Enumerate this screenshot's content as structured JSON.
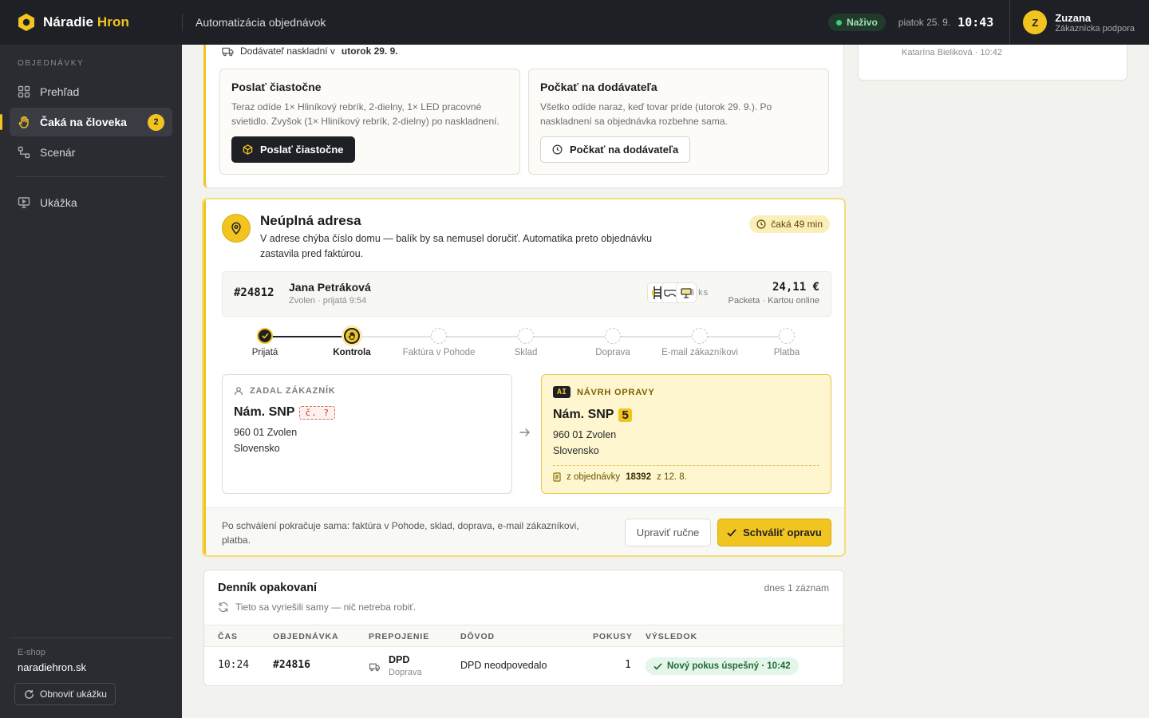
{
  "app": {
    "brand_main": "Náradie",
    "brand_accent": "Hron",
    "title": "Automatizácia objednávok"
  },
  "status": {
    "live": "Naživo",
    "date": "piatok 25. 9.",
    "time": "10:43"
  },
  "user": {
    "initial": "Z",
    "name": "Zuzana",
    "role": "Zákaznícka podpora"
  },
  "sidebar": {
    "section": "OBJEDNÁVKY",
    "items": [
      {
        "label": "Prehľad",
        "icon": "grid-icon"
      },
      {
        "label": "Čaká na človeka",
        "icon": "hand-icon",
        "badge": "2",
        "active": true
      },
      {
        "label": "Scenár",
        "icon": "flow-icon"
      }
    ],
    "extra": {
      "label": "Ukážka",
      "icon": "monitor-icon"
    },
    "footer": {
      "label": "E-shop",
      "value": "naradiehron.sk",
      "reset": "Obnoviť ukážku"
    }
  },
  "stock_card": {
    "supplier_prefix": "Dodávateľ naskladní v",
    "supplier_date": "utorok 29. 9.",
    "options": [
      {
        "title": "Poslať čiastočne",
        "text": "Teraz odíde 1× Hliníkový rebrík, 2-dielny, 1× LED pracovné svietidlo. Zvyšok (1× Hliníkový rebrík, 2-dielny) po naskladnení.",
        "button": "Poslať čiastočne"
      },
      {
        "title": "Počkať na dodávateľa",
        "text": "Všetko odíde naraz, keď tovar príde (utorok 29. 9.). Po naskladnení sa objednávka rozbehne sama.",
        "button": "Počkať na dodávateľa"
      }
    ]
  },
  "address_card": {
    "title": "Neúplná adresa",
    "desc": "V adrese chýba číslo domu — balík by sa nemusel doručiť. Automatika preto objednávku zastavila pred faktúrou.",
    "wait": "čaká 49 min",
    "order": {
      "id": "#24812",
      "name": "Jana Petráková",
      "sub": "Zvolen · prijatá 9:54",
      "qty": "3 ks",
      "price": "24,11 €",
      "payment": "Packeta · Kartou online"
    },
    "steps": [
      {
        "label": "Prijatá",
        "state": "done"
      },
      {
        "label": "Kontrola",
        "state": "current"
      },
      {
        "label": "Faktúra v Pohode",
        "state": "todo"
      },
      {
        "label": "Sklad",
        "state": "todo"
      },
      {
        "label": "Doprava",
        "state": "todo"
      },
      {
        "label": "E-mail zákazníkovi",
        "state": "todo"
      },
      {
        "label": "Platba",
        "state": "todo"
      }
    ],
    "original": {
      "header": "ZADAL ZÁKAZNÍK",
      "street": "Nám. SNP",
      "missing": "č. ?",
      "city": "960 01 Zvolen",
      "country": "Slovensko"
    },
    "proposal": {
      "tag": "AI",
      "header": "NÁVRH OPRAVY",
      "street": "Nám. SNP",
      "number": "5",
      "city": "960 01 Zvolen",
      "country": "Slovensko",
      "source_prefix": "z objednávky",
      "source_order": "18392",
      "source_suffix": "z 12. 8."
    },
    "footer_text": "Po schválení pokračuje sama: faktúra v Pohode, sklad, doprava, e-mail zákazníkovi, platba.",
    "edit_button": "Upraviť ručne",
    "approve_button": "Schváliť opravu"
  },
  "retry_log": {
    "title": "Denník opakovaní",
    "count": "dnes 1 záznam",
    "subtitle": "Tieto sa vyriešili samy — nič netreba robiť.",
    "columns": [
      "ČAS",
      "OBJEDNÁVKA",
      "PREPOJENIE",
      "DÔVOD",
      "POKUSY",
      "VÝSLEDOK"
    ],
    "rows": [
      {
        "time": "10:24",
        "order": "#24816",
        "link": "DPD",
        "link_sub": "Doprava",
        "reason": "DPD neodpovedalo",
        "attempts": "1",
        "result": "Nový pokus úspešný · 10:42"
      }
    ]
  },
  "side_card": {
    "author": "Katarína Bieliková · 10:42"
  },
  "colors": {
    "accent": "#f2c41f",
    "dark": "#1f2025",
    "sidebar": "#2b2c32",
    "success": "#1f6b36"
  }
}
